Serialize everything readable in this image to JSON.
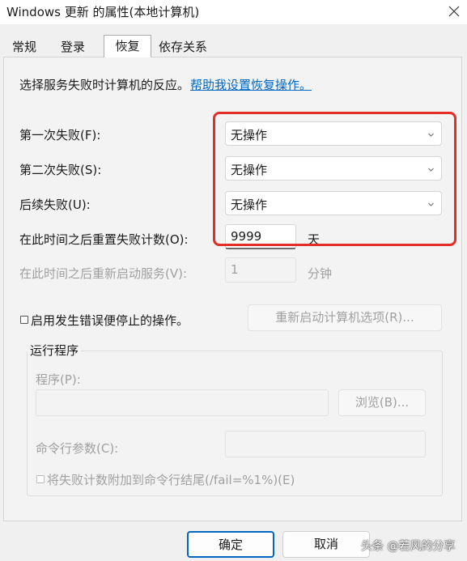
{
  "window": {
    "title": "Windows 更新 的属性(本地计算机)",
    "close_icon": "close-icon"
  },
  "tabs": [
    {
      "label": "常规",
      "active": false
    },
    {
      "label": "登录",
      "active": false
    },
    {
      "label": "恢复",
      "active": true
    },
    {
      "label": "依存关系",
      "active": false
    }
  ],
  "recovery": {
    "intro_text": "选择服务失败时计算机的反应。",
    "help_link": "帮助我设置恢复操作。",
    "first_failure": {
      "label": "第一次失败(F):",
      "value": "无操作"
    },
    "second_failure": {
      "label": "第二次失败(S):",
      "value": "无操作"
    },
    "subsequent_failures": {
      "label": "后续失败(U):",
      "value": "无操作"
    },
    "reset_fail_count": {
      "label": "在此时间之后重置失败计数(O):",
      "value": "9999",
      "unit": "天"
    },
    "restart_service": {
      "label": "在此时间之后重新启动服务(V):",
      "value": "1",
      "unit": "分钟"
    },
    "enable_stop_actions": {
      "label": "启用发生错误便停止的操作。",
      "checked": false
    },
    "restart_computer_options_button": "重新启动计算机选项(R)..."
  },
  "run_program": {
    "group_title": "运行程序",
    "program_label": "程序(P):",
    "program_value": "",
    "browse_button": "浏览(B)...",
    "params_label": "命令行参数(C):",
    "params_value": "",
    "append_fail_count": {
      "label": "将失败计数附加到命令行结尾(/fail=%1%)(E)",
      "checked": false
    }
  },
  "footer": {
    "ok_button": "确定",
    "cancel_button": "取消"
  },
  "overlay": {
    "watermark": "头条 @若风的分享",
    "highlight_color": "#e52d27"
  },
  "colors": {
    "accent": "#0067c0",
    "link": "#0067c0",
    "disabled_text": "#a0a0a0"
  }
}
